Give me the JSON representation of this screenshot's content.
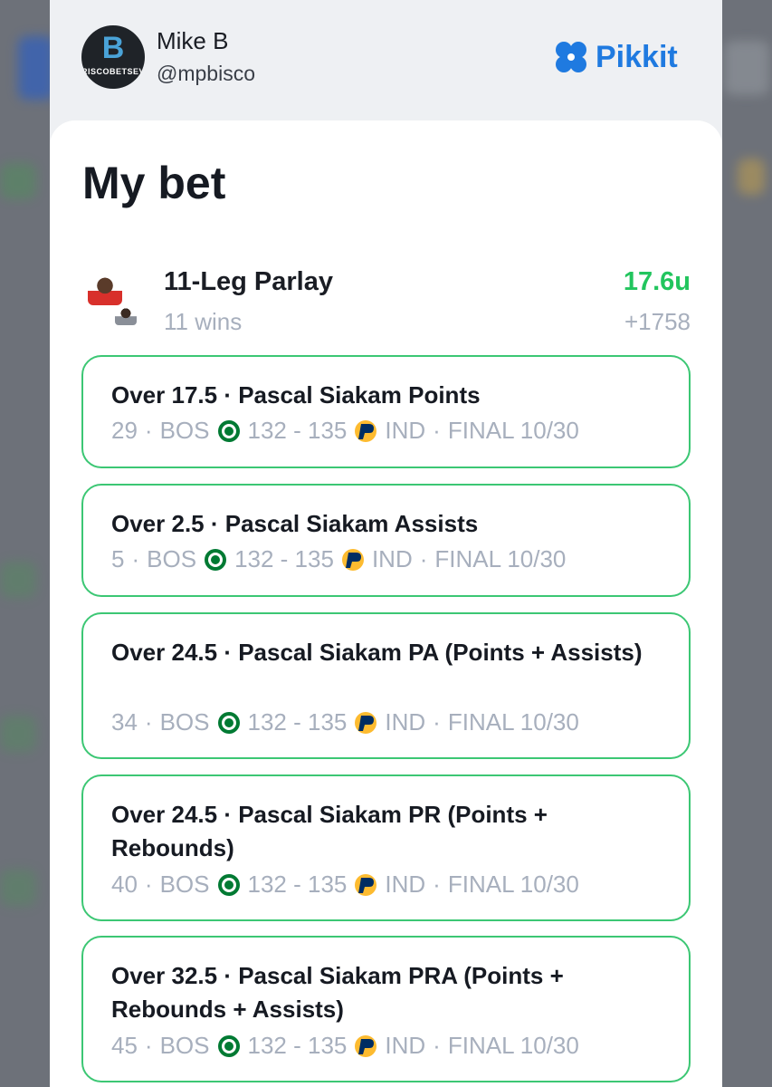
{
  "user": {
    "name": "Mike B",
    "handle": "@mpbisco",
    "avatar_letter": "B",
    "avatar_text": "RISCOBETSEV"
  },
  "brand": {
    "name": "Pikkit",
    "icon": "clover-icon",
    "color": "#1f7ae0"
  },
  "page_title": "My bet",
  "parlay": {
    "title": "11-Leg Parlay",
    "subtitle": "11 wins",
    "units": "17.6u",
    "odds": "+1758"
  },
  "legs": [
    {
      "title": "Over 17.5 · Pascal Siakam Points",
      "stat": "29",
      "home": "BOS",
      "score": "132 - 135",
      "away": "IND",
      "status": "FINAL 10/30"
    },
    {
      "title": "Over 2.5 · Pascal Siakam Assists",
      "stat": "5",
      "home": "BOS",
      "score": "132 - 135",
      "away": "IND",
      "status": "FINAL 10/30"
    },
    {
      "title": "Over 24.5 · Pascal Siakam PA (Points + Assists)",
      "stat": "34",
      "home": "BOS",
      "score": "132 - 135",
      "away": "IND",
      "status": "FINAL 10/30"
    },
    {
      "title": "Over 24.5 · Pascal Siakam PR (Points + Rebounds)",
      "stat": "40",
      "home": "BOS",
      "score": "132 - 135",
      "away": "IND",
      "status": "FINAL 10/30"
    },
    {
      "title": "Over 32.5 · Pascal Siakam PRA (Points + Rebounds + Assists)",
      "stat": "45",
      "home": "BOS",
      "score": "132 - 135",
      "away": "IND",
      "status": "FINAL 10/30"
    }
  ],
  "colors": {
    "win_green": "#22c55e",
    "leg_border": "#3cc774",
    "muted_text": "#a7afbd",
    "celtics_green": "#007a33",
    "pacers_navy": "#002d62",
    "pacers_gold": "#fdbb30"
  }
}
